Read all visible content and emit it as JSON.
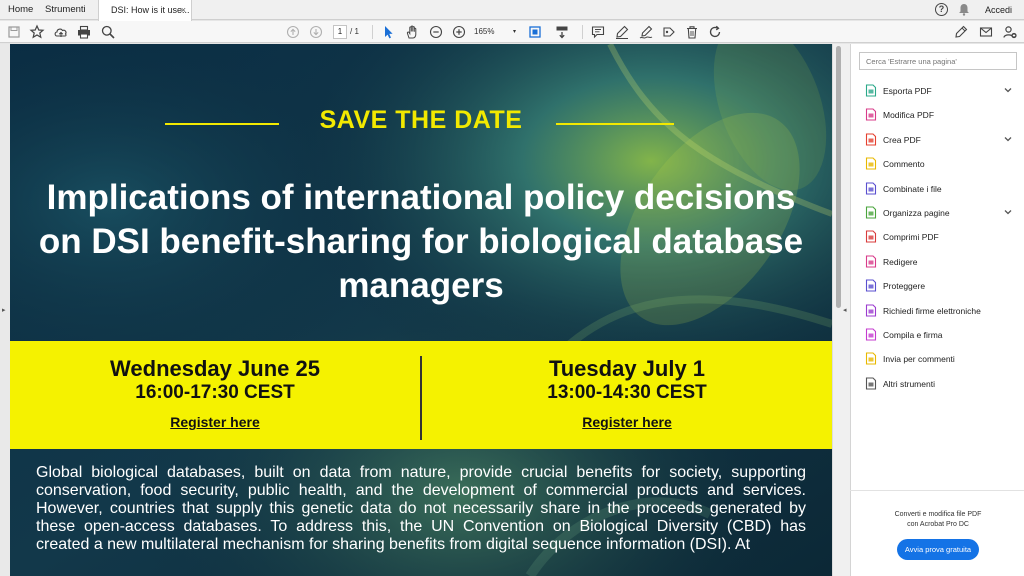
{
  "menubar": {
    "home": "Home",
    "tools": "Strumenti",
    "doc_tab": "DSI: How is it use...",
    "close": "×",
    "login": "Accedi"
  },
  "toolbar": {
    "page_current": "1",
    "page_total": "/ 1",
    "zoom": "165%"
  },
  "flyer": {
    "save_the_date": "SAVE THE DATE",
    "title": "Implications of international policy decisions on DSI benefit-sharing for biological database managers",
    "sessions": [
      {
        "day": "Wednesday June 25",
        "time": "16:00-17:30 CEST",
        "register": "Register here"
      },
      {
        "day": "Tuesday July 1",
        "time": "13:00-14:30 CEST",
        "register": "Register here"
      }
    ],
    "body": "Global biological databases, built on data from nature, provide crucial benefits for society, supporting conservation, food security, public health, and the development of commercial products and services. However, countries that supply this genetic data do not necessarily share in the proceeds generated by these open-access databases. To address this, the UN Convention on Biological Diversity (CBD) has created a new multilateral mechanism for sharing benefits from digital sequence information (DSI). At"
  },
  "right_panel": {
    "search_placeholder": "Cerca 'Estrarre una pagina'",
    "tools": [
      {
        "label": "Esporta PDF",
        "icon": "export-pdf-icon",
        "color": "#2aa889",
        "chevron": true
      },
      {
        "label": "Modifica PDF",
        "icon": "edit-pdf-icon",
        "color": "#d83b8a",
        "chevron": false
      },
      {
        "label": "Crea PDF",
        "icon": "create-pdf-icon",
        "color": "#e5402f",
        "chevron": true
      },
      {
        "label": "Commento",
        "icon": "comment-icon",
        "color": "#e8b800",
        "chevron": false
      },
      {
        "label": "Combinate i file",
        "icon": "combine-files-icon",
        "color": "#5a4fcf",
        "chevron": false
      },
      {
        "label": "Organizza pagine",
        "icon": "organize-pages-icon",
        "color": "#4aa53c",
        "chevron": true
      },
      {
        "label": "Comprimi PDF",
        "icon": "compress-pdf-icon",
        "color": "#d83b3b",
        "chevron": false
      },
      {
        "label": "Redigere",
        "icon": "redact-icon",
        "color": "#d83b8a",
        "chevron": false
      },
      {
        "label": "Proteggere",
        "icon": "protect-icon",
        "color": "#5a4fcf",
        "chevron": false
      },
      {
        "label": "Richiedi firme elettroniche",
        "icon": "request-signatures-icon",
        "color": "#9b3bcf",
        "chevron": false
      },
      {
        "label": "Compila e firma",
        "icon": "fill-sign-icon",
        "color": "#c43bcf",
        "chevron": false
      },
      {
        "label": "Invia per commenti",
        "icon": "send-for-comments-icon",
        "color": "#e8b800",
        "chevron": false
      },
      {
        "label": "Altri strumenti",
        "icon": "more-tools-icon",
        "color": "#555555",
        "chevron": false
      }
    ],
    "promo_line1": "Converti e modifica file PDF",
    "promo_line2": "con Acrobat Pro DC",
    "trial_button": "Avvia prova gratuita"
  },
  "colors": {
    "accent_yellow": "#f5f200",
    "page_dark": "#0d2a3a",
    "button_blue": "#1473e6"
  }
}
